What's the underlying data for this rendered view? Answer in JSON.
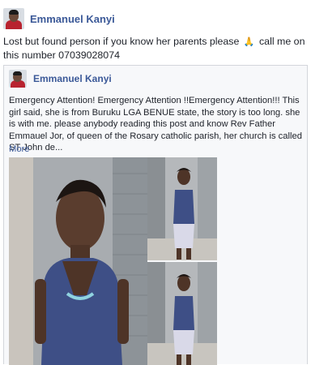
{
  "post": {
    "author": "Emmanuel Kanyi",
    "text_before_emoji": "Lost but found person if you know her parents please",
    "emoji": "🙏",
    "text_after_emoji": "call me on this number 07039028074"
  },
  "shared_post": {
    "author": "Emmanuel Kanyi",
    "text": "Emergency Attention! Emergency Attention !!Emergency Attention!!! This girl said, she is from Buruku LGA BENUE state, the story is too long. she is with me. please anybody reading this post and know Rev Father Emmauel Jor, of queen of the Rosary catholic parish, her church is called ST John de...",
    "more_label": "More"
  },
  "colors": {
    "name_link": "#3b5998",
    "text": "#1d2129",
    "shared_bg": "#f7f8fa",
    "border": "#d3d6db"
  },
  "icons": [
    "person-avatar",
    "praying-hands-emoji",
    "person-avatar"
  ]
}
